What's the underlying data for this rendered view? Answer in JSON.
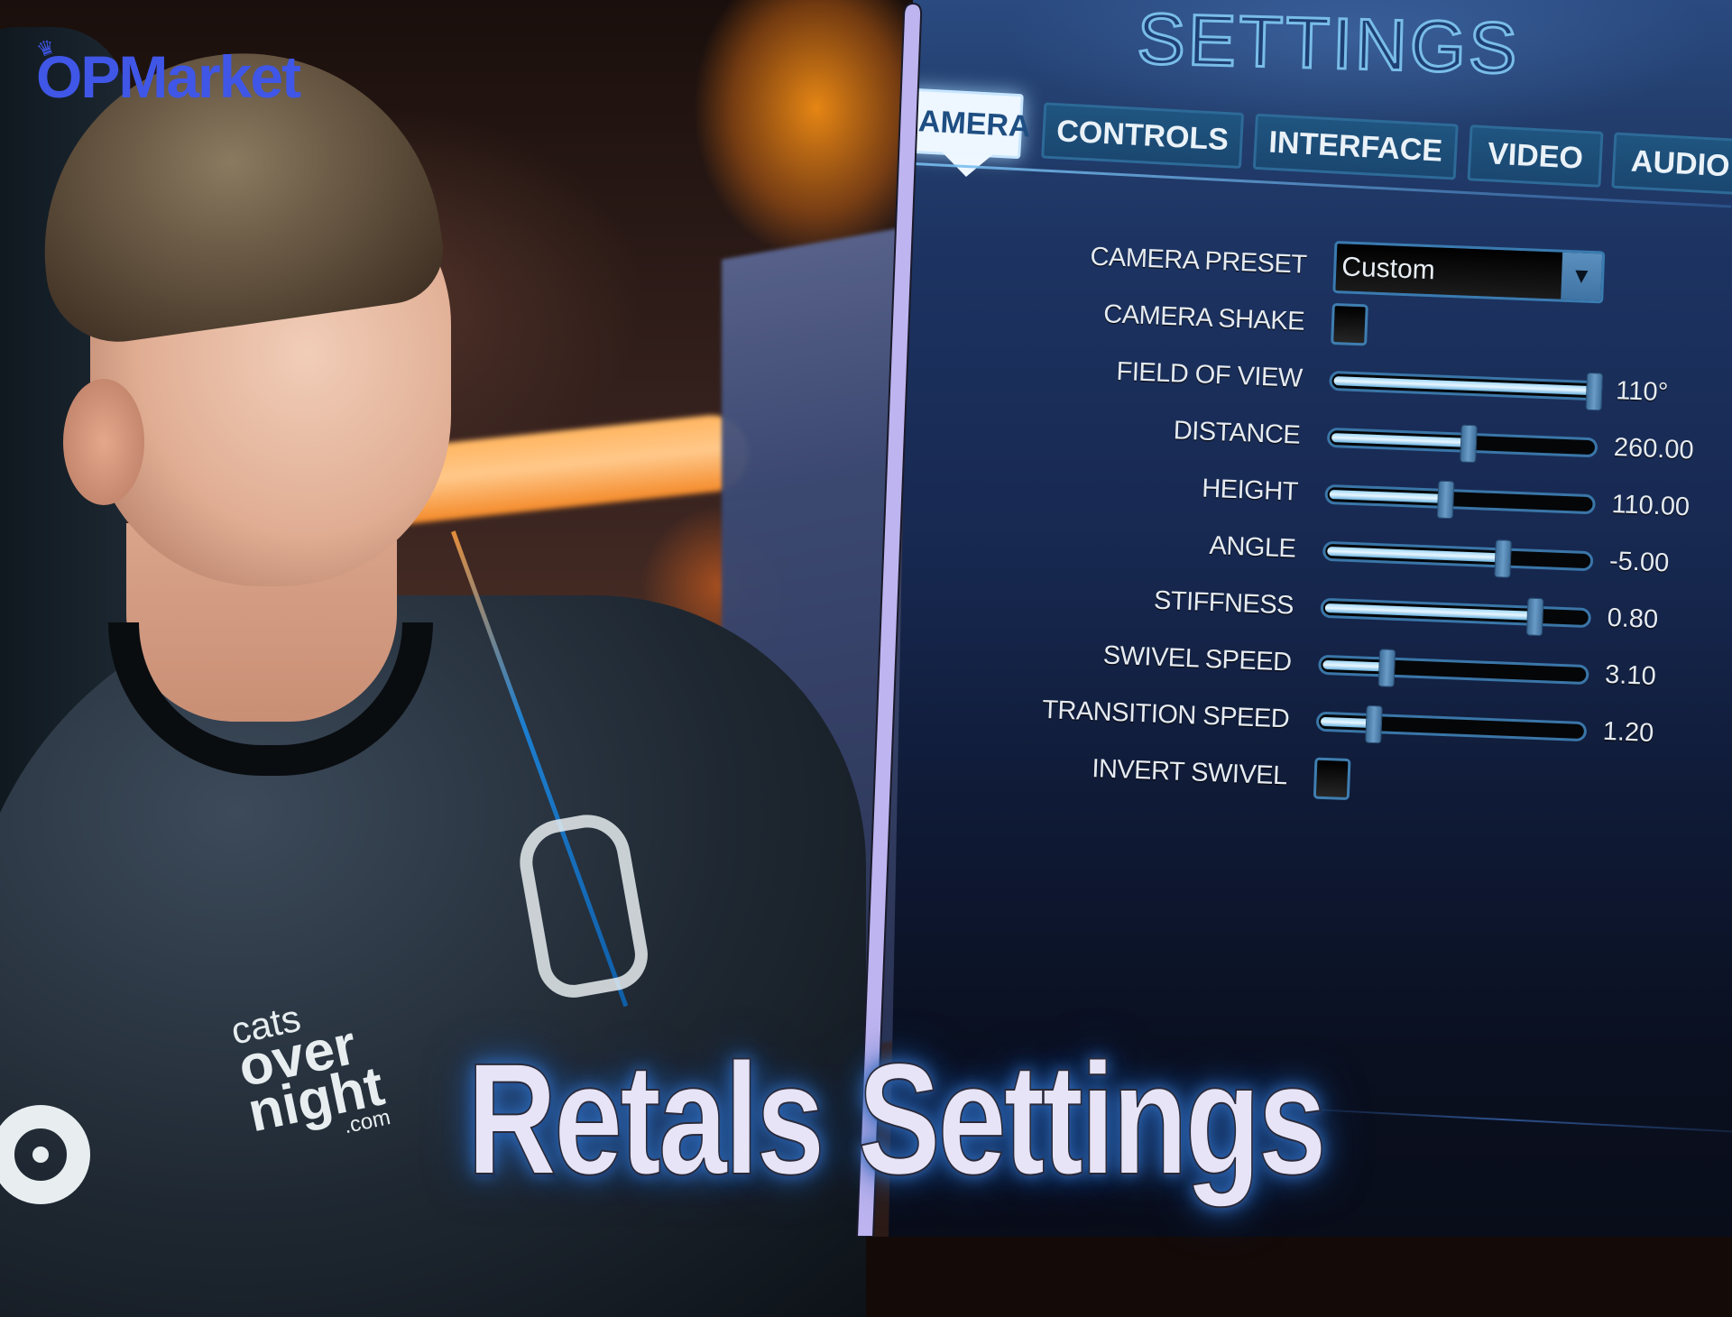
{
  "brand": {
    "logo_text": "OPMarket",
    "logo_color": "#3f56e6",
    "crown_icon": "crown-icon"
  },
  "photo": {
    "subject": "player at desk wearing team jersey",
    "jersey_sponsor_lines": [
      "cats",
      "over",
      "night",
      ".com"
    ]
  },
  "settings_panel": {
    "title": "SETTINGS",
    "tabs": [
      {
        "label": "CAMERA",
        "active": true
      },
      {
        "label": "CONTROLS",
        "active": false
      },
      {
        "label": "INTERFACE",
        "active": false
      },
      {
        "label": "VIDEO",
        "active": false
      },
      {
        "label": "AUDIO",
        "active": false
      }
    ],
    "rows": [
      {
        "label": "CAMERA PRESET",
        "type": "dropdown",
        "value": "Custom"
      },
      {
        "label": "CAMERA SHAKE",
        "type": "checkbox",
        "checked": false
      },
      {
        "label": "FIELD OF VIEW",
        "type": "slider",
        "value": "110°",
        "fraction": 1.0
      },
      {
        "label": "DISTANCE",
        "type": "slider",
        "value": "260.00",
        "fraction": 0.52
      },
      {
        "label": "HEIGHT",
        "type": "slider",
        "value": "110.00",
        "fraction": 0.44
      },
      {
        "label": "ANGLE",
        "type": "slider",
        "value": "-5.00",
        "fraction": 0.67
      },
      {
        "label": "STIFFNESS",
        "type": "slider",
        "value": "0.80",
        "fraction": 0.8
      },
      {
        "label": "SWIVEL SPEED",
        "type": "slider",
        "value": "3.10",
        "fraction": 0.24
      },
      {
        "label": "TRANSITION SPEED",
        "type": "slider",
        "value": "1.20",
        "fraction": 0.2
      },
      {
        "label": "INVERT SWIVEL",
        "type": "checkbox",
        "checked": false
      }
    ]
  },
  "headline": {
    "text": "Retals Settings"
  },
  "colors": {
    "divider": "#bdb4f0",
    "panel_bg": "#1c3260",
    "tab_active_bg": "#eef7ff",
    "slider_fill": "#9fd7f7",
    "headline_fill": "#e6e4f6",
    "headline_glow": "#2f6fbf"
  }
}
